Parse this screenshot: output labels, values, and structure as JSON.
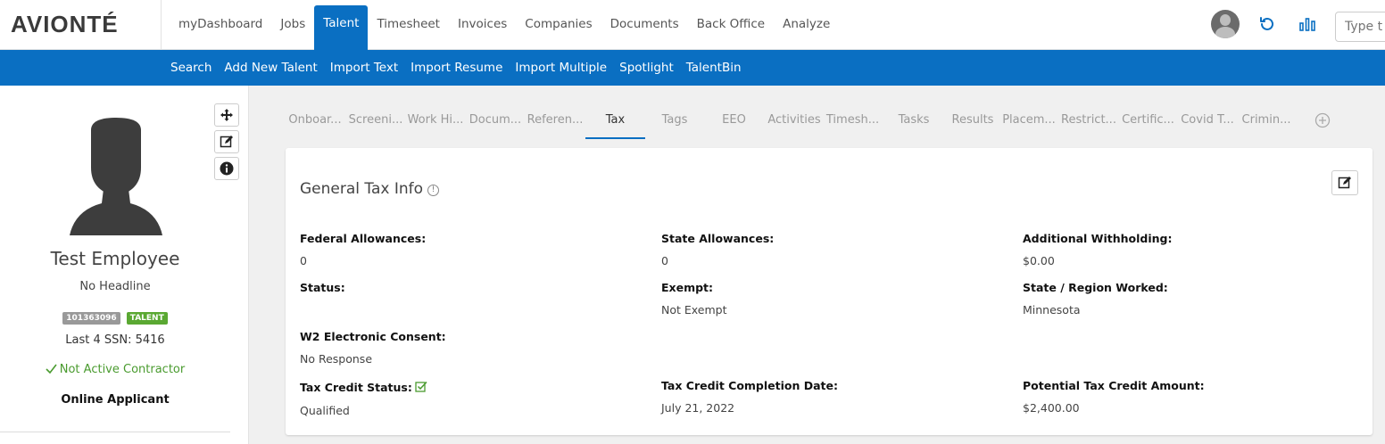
{
  "app": {
    "logo": "AVIONTÉ"
  },
  "nav": {
    "items": [
      {
        "label": "myDashboard"
      },
      {
        "label": "Jobs"
      },
      {
        "label": "Talent"
      },
      {
        "label": "Timesheet"
      },
      {
        "label": "Invoices"
      },
      {
        "label": "Companies"
      },
      {
        "label": "Documents"
      },
      {
        "label": "Back Office"
      },
      {
        "label": "Analyze"
      }
    ],
    "active": "Talent",
    "search_placeholder": "Type t"
  },
  "subnav": {
    "items": [
      {
        "label": "Search"
      },
      {
        "label": "Add New Talent"
      },
      {
        "label": "Import Text"
      },
      {
        "label": "Import Resume"
      },
      {
        "label": "Import Multiple"
      },
      {
        "label": "Spotlight"
      },
      {
        "label": "TalentBin"
      }
    ]
  },
  "profile": {
    "name": "Test Employee",
    "headline": "No Headline",
    "id_badge": "101363096",
    "type_badge": "TALENT",
    "ssn": "Last 4 SSN: 5416",
    "contractor": "Not Active Contractor",
    "applicant": "Online Applicant"
  },
  "tabs": [
    {
      "label": "Onboar..."
    },
    {
      "label": "Screeni..."
    },
    {
      "label": "Work Hi..."
    },
    {
      "label": "Docum..."
    },
    {
      "label": "Referen..."
    },
    {
      "label": "Tax"
    },
    {
      "label": "Tags"
    },
    {
      "label": "EEO"
    },
    {
      "label": "Activities"
    },
    {
      "label": "Timesh..."
    },
    {
      "label": "Tasks"
    },
    {
      "label": "Results"
    },
    {
      "label": "Placem..."
    },
    {
      "label": "Restrict..."
    },
    {
      "label": "Certific..."
    },
    {
      "label": "Covid T..."
    },
    {
      "label": "Crimin..."
    }
  ],
  "active_tab": "Tax",
  "tax": {
    "title": "General Tax Info",
    "info_icon": "!",
    "fields": {
      "federal_allowances": {
        "label": "Federal Allowances:",
        "value": "0"
      },
      "state_allowances": {
        "label": "State Allowances:",
        "value": "0"
      },
      "additional_withholding": {
        "label": "Additional Withholding:",
        "value": "$0.00"
      },
      "status": {
        "label": "Status:",
        "value": ""
      },
      "exempt": {
        "label": "Exempt:",
        "value": "Not Exempt"
      },
      "state_region": {
        "label": "State / Region Worked:",
        "value": "Minnesota"
      },
      "w2_consent": {
        "label": "W2 Electronic Consent:",
        "value": "No Response"
      },
      "tax_credit_status": {
        "label": "Tax Credit Status:",
        "value": "Qualified"
      },
      "tax_credit_date": {
        "label": "Tax Credit Completion Date:",
        "value": "July 21, 2022"
      },
      "tax_credit_amount": {
        "label": "Potential Tax Credit Amount:",
        "value": "$2,400.00"
      }
    }
  },
  "colors": {
    "primary": "#0a6fc2",
    "success": "#4a9b2f",
    "badge_gray": "#999999",
    "badge_green": "#5aa832"
  }
}
